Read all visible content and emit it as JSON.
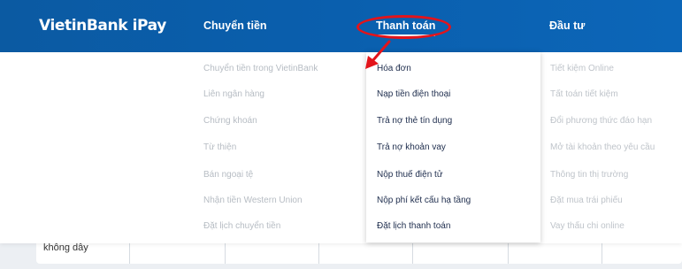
{
  "header": {
    "logo": "VietinBank iPay",
    "nav": [
      "Chuyển tiền",
      "Thanh toán",
      "Đầu tư"
    ]
  },
  "menu": {
    "col1": [
      "Chuyển tiền trong VietinBank",
      "Liên ngân hàng",
      "Chứng khoán",
      "Từ thiện",
      "Bán ngoại tệ",
      "Nhận tiền Western Union",
      "Đặt lịch chuyển tiền"
    ],
    "col2": [
      "Hóa đơn",
      "Nạp tiền điện thoại",
      "Trả nợ thẻ tín dụng",
      "Trả nợ khoản vay",
      "Nộp thuế điện tử",
      "Nộp phí kết cấu hạ tầng",
      "Đặt lịch thanh toán"
    ],
    "col3": [
      "Tiết kiệm Online",
      "Tất toán tiết kiệm",
      "Đổi phương thức đáo hạn",
      "Mở tài khoản theo yêu cầu",
      "Thông tin thị trường",
      "Đặt mua trái phiếu",
      "Vay thấu chi online"
    ]
  },
  "bottom": {
    "text": "không dây"
  },
  "colors": {
    "header": "#0b5aa2",
    "highlight": "#e3141b",
    "menu_dim": "#b6bcc3",
    "menu_dark": "#1e2d4d"
  }
}
